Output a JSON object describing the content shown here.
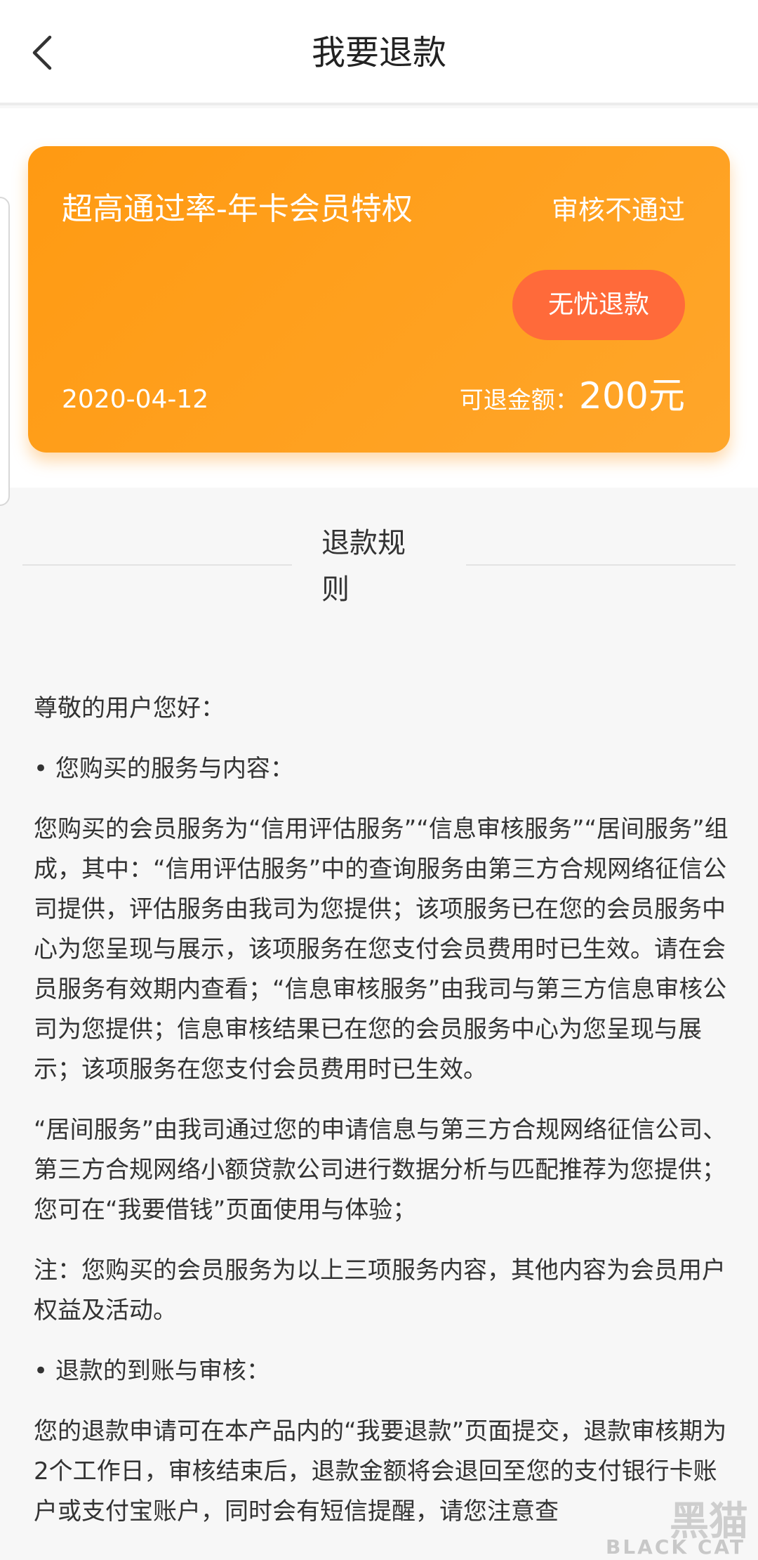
{
  "header": {
    "title": "我要退款"
  },
  "card": {
    "product": "超高通过率-年卡会员特权",
    "status": "审核不通过",
    "refund_button": "无忧退款",
    "date": "2020-04-12",
    "amount_label": "可退金额：",
    "amount_value": "200元"
  },
  "rules": {
    "title": "退款规则",
    "paragraphs": [
      "尊敬的用户您好：",
      "• 您购买的服务与内容：",
      "您购买的会员服务为“信用评估服务”“信息审核服务”“居间服务”组成，其中：“信用评估服务”中的查询服务由第三方合规网络征信公司提供，评估服务由我司为您提供；该项服务已在您的会员服务中心为您呈现与展示，该项服务在您支付会员费用时已生效。请在会员服务有效期内查看；“信息审核服务”由我司与第三方信息审核公司为您提供；信息审核结果已在您的会员服务中心为您呈现与展示；该项服务在您支付会员费用时已生效。",
      "“居间服务”由我司通过您的申请信息与第三方合规网络征信公司、第三方合规网络小额贷款公司进行数据分析与匹配推荐为您提供；您可在“我要借钱”页面使用与体验；",
      "注：您购买的会员服务为以上三项服务内容，其他内容为会员用户权益及活动。",
      "• 退款的到账与审核：",
      "您的退款申请可在本产品内的“我要退款”页面提交，退款审核期为2个工作日，审核结束后，退款金额将会退回至您的支付银行卡账户或支付宝账户，同时会有短信提醒，请您注意查"
    ]
  },
  "watermark": {
    "main": "黑猫",
    "sub": "BLACK CAT"
  },
  "colors": {
    "card_start": "#ff9a12",
    "card_end": "#ffa62a",
    "button": "#ff6a3a"
  },
  "icons": {
    "back": "chevron-left-icon"
  }
}
